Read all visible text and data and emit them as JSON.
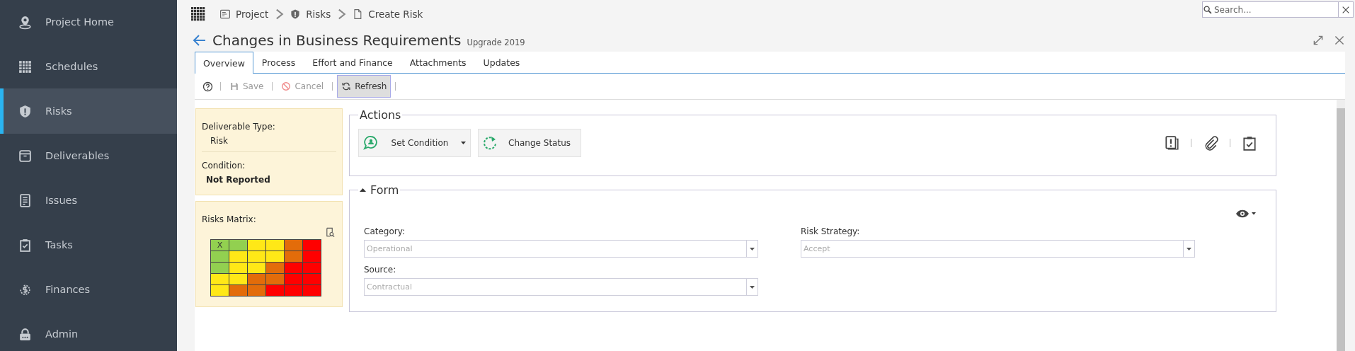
{
  "sidebar": {
    "items": [
      {
        "label": "Project Home",
        "selected": false
      },
      {
        "label": "Schedules",
        "selected": false
      },
      {
        "label": "Risks",
        "selected": true
      },
      {
        "label": "Deliverables",
        "selected": false
      },
      {
        "label": "Issues",
        "selected": false
      },
      {
        "label": "Tasks",
        "selected": false
      },
      {
        "label": "Finances",
        "selected": false
      },
      {
        "label": "Admin",
        "selected": false
      }
    ]
  },
  "breadcrumb": [
    "Project",
    "Risks",
    "Create Risk"
  ],
  "search": {
    "placeholder": "Search..."
  },
  "header": {
    "title": "Changes in Business Requirements",
    "subtitle": "Upgrade 2019"
  },
  "tabs": [
    {
      "label": "Overview",
      "selected": true
    },
    {
      "label": "Process",
      "selected": false
    },
    {
      "label": "Effort and Finance",
      "selected": false
    },
    {
      "label": "Attachments",
      "selected": false
    },
    {
      "label": "Updates",
      "selected": false
    }
  ],
  "toolbar": [
    {
      "kind": "help"
    },
    {
      "kind": "button",
      "label": "Save",
      "disabled": true,
      "focused": false
    },
    {
      "kind": "button",
      "label": "Cancel",
      "disabled": true,
      "focused": false
    },
    {
      "kind": "button",
      "label": "Refresh",
      "disabled": false,
      "focused": true
    }
  ],
  "info": [
    {
      "label": "Deliverable Type:",
      "value": "Risk",
      "bold": false
    },
    {
      "label": "Condition:",
      "value": "Not Reported",
      "bold": true
    }
  ],
  "risks_matrix": {
    "label": "Risks Matrix:",
    "rows": [
      {
        "cells": [
          {
            "color": "#92d050",
            "mark": "X"
          },
          {
            "color": "#92d050"
          },
          {
            "color": "#ffe817"
          },
          {
            "color": "#ffe817"
          },
          {
            "color": "#e36c0a"
          },
          {
            "color": "#ff0000"
          }
        ]
      },
      {
        "cells": [
          {
            "color": "#92d050"
          },
          {
            "color": "#ffe817"
          },
          {
            "color": "#ffe817"
          },
          {
            "color": "#ffe817"
          },
          {
            "color": "#e36c0a"
          },
          {
            "color": "#ff0000"
          }
        ]
      },
      {
        "cells": [
          {
            "color": "#92d050"
          },
          {
            "color": "#ffe817"
          },
          {
            "color": "#ffe817"
          },
          {
            "color": "#e36c0a"
          },
          {
            "color": "#ff0000"
          },
          {
            "color": "#ff0000"
          }
        ]
      },
      {
        "cells": [
          {
            "color": "#ffe817"
          },
          {
            "color": "#ffe817"
          },
          {
            "color": "#e36c0a"
          },
          {
            "color": "#e36c0a"
          },
          {
            "color": "#ff0000"
          },
          {
            "color": "#ff0000"
          }
        ]
      },
      {
        "cells": [
          {
            "color": "#ffe817"
          },
          {
            "color": "#e36c0a"
          },
          {
            "color": "#e36c0a"
          },
          {
            "color": "#ff0000"
          },
          {
            "color": "#ff0000"
          },
          {
            "color": "#ff0000"
          }
        ]
      }
    ]
  },
  "actions": {
    "title": "Actions",
    "buttons": [
      {
        "label": "Set Condition",
        "dropdown": true
      },
      {
        "label": "Change Status",
        "dropdown": false
      }
    ]
  },
  "form": {
    "title": "Form",
    "expanded": true,
    "fields": [
      {
        "label": "Category:",
        "value": "Operational",
        "disabled": true
      },
      {
        "label": "Risk Strategy:",
        "value": "Accept",
        "disabled": true
      },
      {
        "label": "Source:",
        "value": "Contractual",
        "disabled": true
      }
    ]
  }
}
